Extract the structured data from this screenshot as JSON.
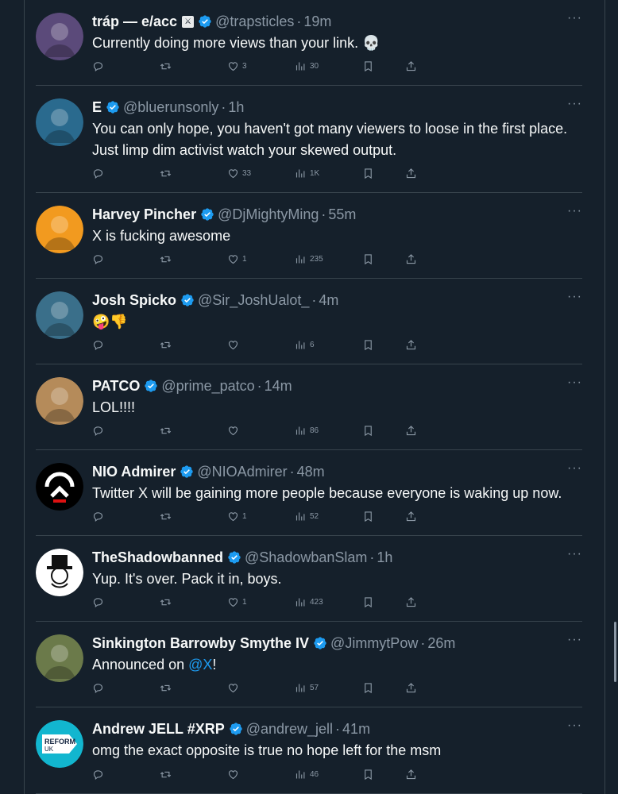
{
  "tweets": [
    {
      "name": "tráp — e/acc",
      "flag": "⚔",
      "verified": true,
      "handle": "@trapsticles",
      "time": "19m",
      "text": "Currently doing more views than your link. 💀",
      "replies": "",
      "retweets": "",
      "likes": "3",
      "views": "30",
      "avatar_color": "#5b4a7a",
      "avatar_name": "masked-figure-avatar"
    },
    {
      "name": "E",
      "verified": true,
      "handle": "@bluerunsonly",
      "time": "1h",
      "text": "You can only hope, you haven't got many viewers to loose in the first place. Just limp dim activist watch your skewed output.",
      "replies": "",
      "retweets": "",
      "likes": "33",
      "views": "1K",
      "avatar_color": "#2a6a8e",
      "avatar_name": "swimmer-avatar"
    },
    {
      "name": "Harvey Pincher",
      "verified": true,
      "handle": "@DjMightyMing",
      "time": "55m",
      "text": "X is fucking awesome",
      "replies": "",
      "retweets": "",
      "likes": "1",
      "views": "235",
      "avatar_color": "#f29a1f",
      "avatar_name": "laser-eyes-avatar"
    },
    {
      "name": "Josh Spicko",
      "verified": true,
      "handle": "@Sir_JoshUalot_",
      "time": "4m",
      "text": "🤪👎",
      "replies": "",
      "retweets": "",
      "likes": "",
      "views": "6",
      "avatar_color": "#3a6f8a",
      "avatar_name": "doge-sunglasses-avatar"
    },
    {
      "name": "PATCO",
      "verified": true,
      "handle": "@prime_patco",
      "time": "14m",
      "text": "LOL!!!!",
      "replies": "",
      "retweets": "",
      "likes": "",
      "views": "86",
      "avatar_color": "#b58b5a",
      "avatar_name": "woman-portrait-avatar"
    },
    {
      "name": "NIO Admirer",
      "verified": true,
      "handle": "@NIOAdmirer",
      "time": "48m",
      "text": "Twitter X will be gaining more people because everyone is waking up now.",
      "replies": "",
      "retweets": "",
      "likes": "1",
      "views": "52",
      "avatar_color": "#000000",
      "avatar_name": "nio-logo-avatar"
    },
    {
      "name": "TheShadowbanned",
      "verified": true,
      "handle": "@ShadowbanSlam",
      "time": "1h",
      "text": "Yup. It's over. Pack it in, boys.",
      "replies": "",
      "retweets": "",
      "likes": "1",
      "views": "423",
      "avatar_color": "#ffffff",
      "avatar_name": "monopoly-man-avatar"
    },
    {
      "name": "Sinkington Barrowby Smythe IV",
      "verified": true,
      "handle": "@JimmytPow",
      "time": "26m",
      "text_before": "Announced on ",
      "mention": "@X",
      "text_after": "!",
      "replies": "",
      "retweets": "",
      "likes": "",
      "views": "57",
      "avatar_color": "#6b7a4a",
      "avatar_name": "dog-in-field-avatar"
    },
    {
      "name": "Andrew JELL #XRP",
      "verified": true,
      "handle": "@andrew_jell",
      "time": "41m",
      "text": "omg the exact opposite is true no hope left for the msm",
      "replies": "",
      "retweets": "",
      "likes": "",
      "views": "46",
      "avatar_color": "#ffffff",
      "avatar_name": "reform-uk-avatar",
      "avatar_text_1": "REFORM",
      "avatar_text_2": "UK"
    }
  ],
  "more_label": "···",
  "colors": {
    "background": "#15202b",
    "text": "#f7f9f9",
    "secondary": "#8b98a5",
    "accent": "#1d9bf0",
    "divider": "#38444d"
  }
}
